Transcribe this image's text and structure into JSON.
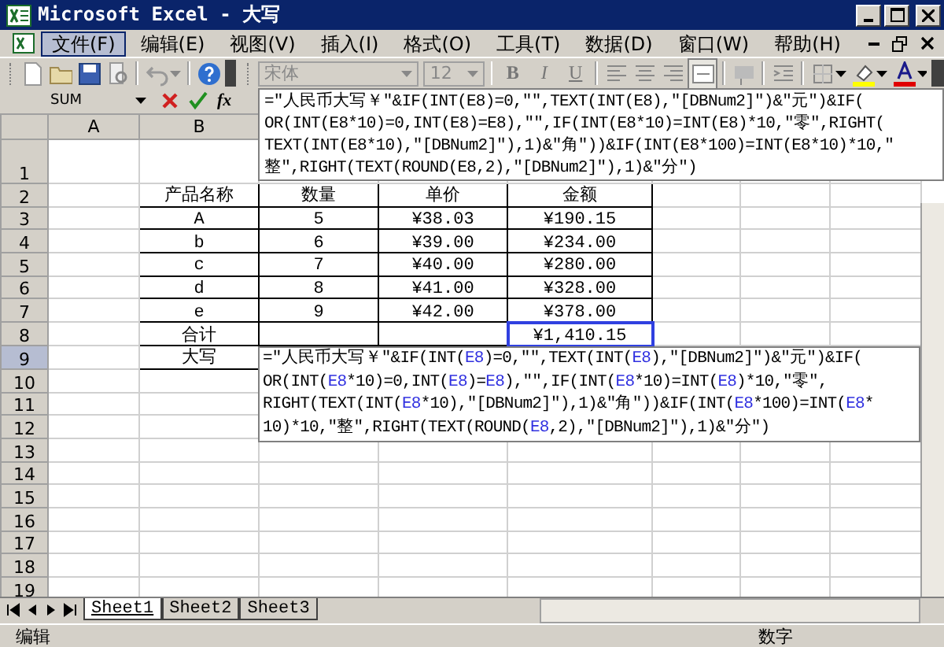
{
  "window": {
    "title": "Microsoft Excel - 大写"
  },
  "menu": [
    {
      "label": "文件(F)",
      "selected": true
    },
    {
      "label": "编辑(E)",
      "selected": false
    },
    {
      "label": "视图(V)",
      "selected": false
    },
    {
      "label": "插入(I)",
      "selected": false
    },
    {
      "label": "格式(O)",
      "selected": false
    },
    {
      "label": "工具(T)",
      "selected": false
    },
    {
      "label": "数据(D)",
      "selected": false
    },
    {
      "label": "窗口(W)",
      "selected": false
    },
    {
      "label": "帮助(H)",
      "selected": false
    }
  ],
  "toolbar": {
    "font": "宋体",
    "size": "12",
    "format_buttons": [
      "B",
      "I",
      "U"
    ]
  },
  "formula_bar": {
    "name_box": "SUM",
    "function_label": "fx",
    "lines": [
      "=\"人民币大写￥\"&IF(INT(E8)=0,\"\",TEXT(INT(E8),\"[DBNum2]\")&\"元\")&IF(",
      "OR(INT(E8*10)=0,INT(E8)=E8),\"\",IF(INT(E8*10)=INT(E8)*10,\"零\",RIGHT(",
      "TEXT(INT(E8*10),\"[DBNum2]\"),1)&\"角\"))&IF(INT(E8*100)=INT(E8*10)*10,\"",
      "整\",RIGHT(TEXT(ROUND(E8,2),\"[DBNum2]\"),1)&\"分\")"
    ]
  },
  "sheet": {
    "columns": [
      "A",
      "B"
    ],
    "rows": [
      {
        "number": "1",
        "selected": false,
        "bordered": false
      },
      {
        "number": "2",
        "selected": false,
        "bordered": true,
        "cells": [
          {
            "text": "产品名称",
            "selected": false
          },
          {
            "text": "数量",
            "selected": false
          },
          {
            "text": "单价",
            "selected": false
          },
          {
            "text": "金额",
            "selected": false
          }
        ]
      },
      {
        "number": "3",
        "selected": false,
        "bordered": true,
        "cells": [
          {
            "text": "A",
            "selected": false
          },
          {
            "text": "5",
            "selected": false
          },
          {
            "text": "¥38.03",
            "selected": false
          },
          {
            "text": "¥190.15",
            "selected": false
          }
        ]
      },
      {
        "number": "4",
        "selected": false,
        "bordered": true,
        "cells": [
          {
            "text": "b",
            "selected": false
          },
          {
            "text": "6",
            "selected": false
          },
          {
            "text": "¥39.00",
            "selected": false
          },
          {
            "text": "¥234.00",
            "selected": false
          }
        ]
      },
      {
        "number": "5",
        "selected": false,
        "bordered": true,
        "cells": [
          {
            "text": "c",
            "selected": false
          },
          {
            "text": "7",
            "selected": false
          },
          {
            "text": "¥40.00",
            "selected": false
          },
          {
            "text": "¥280.00",
            "selected": false
          }
        ]
      },
      {
        "number": "6",
        "selected": false,
        "bordered": true,
        "cells": [
          {
            "text": "d",
            "selected": false
          },
          {
            "text": "8",
            "selected": false
          },
          {
            "text": "¥41.00",
            "selected": false
          },
          {
            "text": "¥328.00",
            "selected": false
          }
        ]
      },
      {
        "number": "7",
        "selected": false,
        "bordered": true,
        "cells": [
          {
            "text": "e",
            "selected": false
          },
          {
            "text": "9",
            "selected": false
          },
          {
            "text": "¥42.00",
            "selected": false
          },
          {
            "text": "¥378.00",
            "selected": false
          }
        ]
      },
      {
        "number": "8",
        "selected": false,
        "bordered": true,
        "cells": [
          {
            "text": "合计",
            "selected": false
          },
          {
            "text": "",
            "selected": false
          },
          {
            "text": "",
            "selected": false
          },
          {
            "text": "¥1,410.15",
            "selected": true
          }
        ]
      },
      {
        "number": "9",
        "selected": true,
        "bordered": true,
        "cells": [
          {
            "text": "大写",
            "selected": false
          }
        ]
      },
      {
        "number": "10",
        "selected": false,
        "bordered": false
      },
      {
        "number": "11",
        "selected": false,
        "bordered": false
      },
      {
        "number": "12",
        "selected": false,
        "bordered": false
      },
      {
        "number": "13",
        "selected": false,
        "bordered": false
      },
      {
        "number": "14",
        "selected": false,
        "bordered": false
      },
      {
        "number": "15",
        "selected": false,
        "bordered": false
      },
      {
        "number": "16",
        "selected": false,
        "bordered": false
      },
      {
        "number": "17",
        "selected": false,
        "bordered": false
      },
      {
        "number": "18",
        "selected": false,
        "bordered": false
      },
      {
        "number": "19",
        "selected": false,
        "bordered": false
      }
    ],
    "cell_editor": [
      [
        {
          "kind": "plain",
          "text": "=\"人民币大写￥\"&IF(INT("
        },
        {
          "kind": "ref",
          "text": "E8"
        },
        {
          "kind": "plain",
          "text": ")=0,\"\",TEXT(INT("
        },
        {
          "kind": "ref",
          "text": "E8"
        },
        {
          "kind": "plain",
          "text": "),\"[DBNum2]\")&\"元\")&IF("
        }
      ],
      [
        {
          "kind": "plain",
          "text": "OR(INT("
        },
        {
          "kind": "ref",
          "text": "E8"
        },
        {
          "kind": "plain",
          "text": "*10)=0,INT("
        },
        {
          "kind": "ref",
          "text": "E8"
        },
        {
          "kind": "plain",
          "text": ")="
        },
        {
          "kind": "ref",
          "text": "E8"
        },
        {
          "kind": "plain",
          "text": "),\"\",IF(INT("
        },
        {
          "kind": "ref",
          "text": "E8"
        },
        {
          "kind": "plain",
          "text": "*10)=INT("
        },
        {
          "kind": "ref",
          "text": "E8"
        },
        {
          "kind": "plain",
          "text": ")*10,\"零\","
        }
      ],
      [
        {
          "kind": "plain",
          "text": "RIGHT(TEXT(INT("
        },
        {
          "kind": "ref",
          "text": "E8"
        },
        {
          "kind": "plain",
          "text": "*10),\"[DBNum2]\"),1)&\"角\"))&IF(INT("
        },
        {
          "kind": "ref",
          "text": "E8"
        },
        {
          "kind": "plain",
          "text": "*100)=INT("
        },
        {
          "kind": "ref",
          "text": "E8"
        },
        {
          "kind": "plain",
          "text": "*"
        }
      ],
      [
        {
          "kind": "plain",
          "text": "10)*10,\"整\",RIGHT(TEXT(ROUND("
        },
        {
          "kind": "ref",
          "text": "E8"
        },
        {
          "kind": "plain",
          "text": ",2),\"[DBNum2]\"),1)&\"分\")"
        }
      ]
    ]
  },
  "sheet_tabs": [
    {
      "label": "Sheet1",
      "selected": true
    },
    {
      "label": "Sheet2",
      "selected": false
    },
    {
      "label": "Sheet3",
      "selected": false
    }
  ],
  "status_bar": {
    "mode": "编辑",
    "indicator": "数字"
  }
}
